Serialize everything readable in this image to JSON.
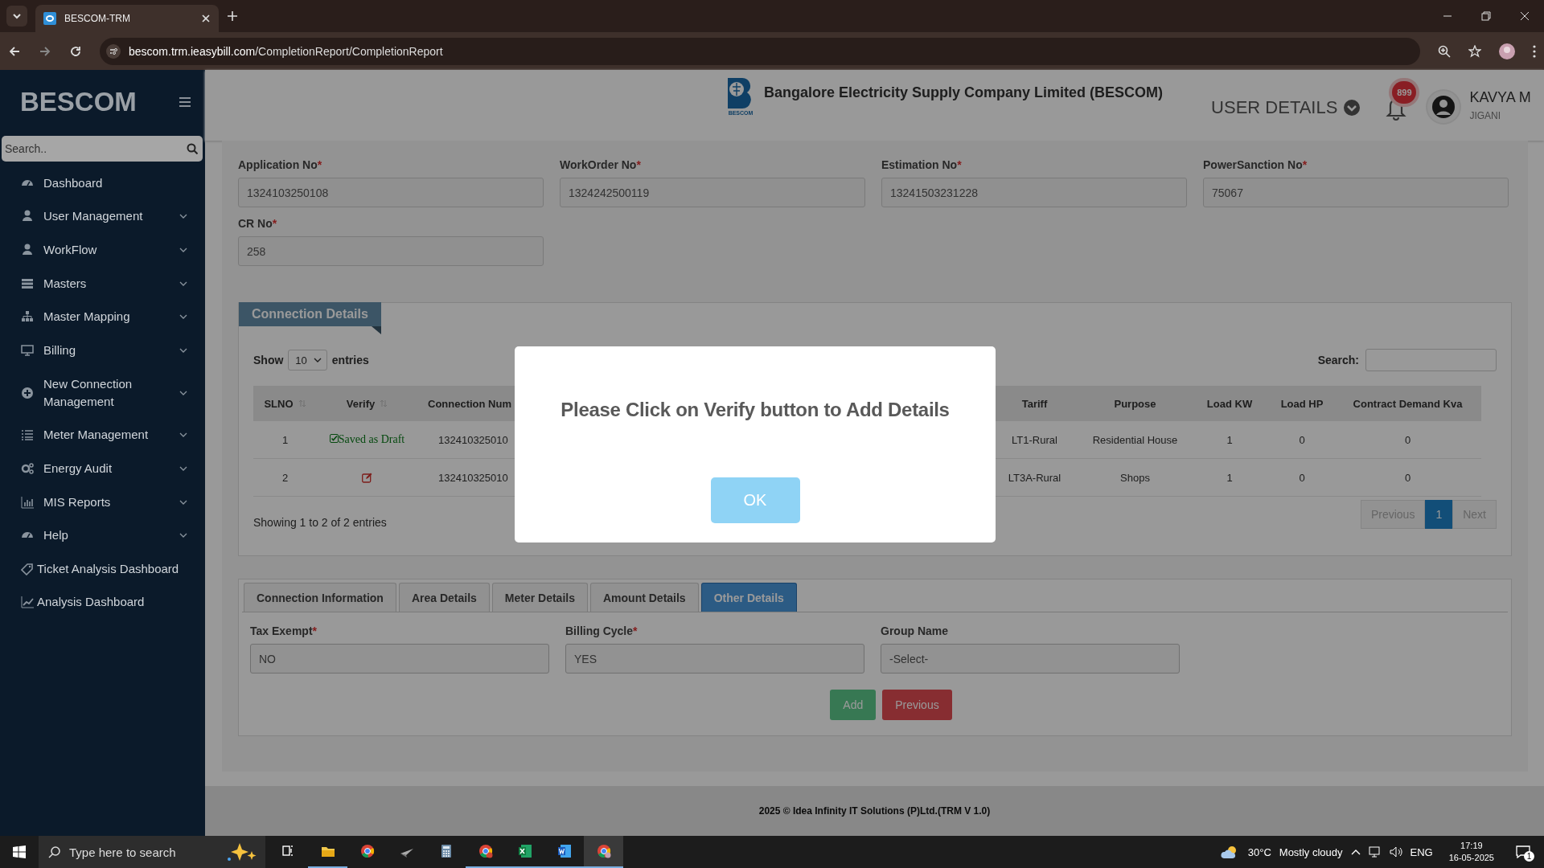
{
  "browser": {
    "tab_title": "BESCOM-TRM",
    "url_host": "bescom.trm.ieasybill.com",
    "url_path": "/CompletionReport/CompletionReport"
  },
  "sidebar": {
    "logo": "BESCOM",
    "search_placeholder": "Search..",
    "items": [
      {
        "label": "Dashboard",
        "submenu": false
      },
      {
        "label": "User Management",
        "submenu": true
      },
      {
        "label": "WorkFlow",
        "submenu": true
      },
      {
        "label": "Masters",
        "submenu": true
      },
      {
        "label": "Master Mapping",
        "submenu": true
      },
      {
        "label": "Billing",
        "submenu": true
      },
      {
        "label": "New Connection Management",
        "submenu": true
      },
      {
        "label": "Meter Management",
        "submenu": true
      },
      {
        "label": "Energy Audit",
        "submenu": true
      },
      {
        "label": "MIS Reports",
        "submenu": true
      },
      {
        "label": "Help",
        "submenu": true
      },
      {
        "label": "Ticket Analysis Dashboard",
        "submenu": false
      },
      {
        "label": "Analysis Dashboard",
        "submenu": false
      }
    ]
  },
  "header": {
    "logo_caption": "BESCOM",
    "company": "Bangalore Electricity Supply Company Limited (BESCOM)",
    "user_menu": "USER DETAILS",
    "notifications": "899",
    "user_name": "KAVYA M",
    "user_location": "JIGANI"
  },
  "fields": [
    {
      "label": "Application No",
      "mark": "*",
      "value": "1324103250108"
    },
    {
      "label": "WorkOrder No",
      "mark": "*",
      "value": "1324242500119"
    },
    {
      "label": "Estimation No",
      "mark": "*",
      "value": "13241503231228"
    },
    {
      "label": "PowerSanction No",
      "mark": "*",
      "value": "75067"
    },
    {
      "label": "CR No",
      "mark": "*",
      "value": "258"
    }
  ],
  "connection_details": {
    "title": "Connection Details",
    "show_label": "Show",
    "page_size": "10",
    "entries_label": "entries",
    "search_label": "Search:",
    "columns": [
      {
        "label": "SLNO",
        "sortable": true
      },
      {
        "label": "Verify",
        "sortable": true
      },
      {
        "label": "Connection Num",
        "sortable": false
      },
      {
        "label": "Tariff",
        "sortable": false
      },
      {
        "label": "Purpose",
        "sortable": false
      },
      {
        "label": "Load KW",
        "sortable": false
      },
      {
        "label": "Load HP",
        "sortable": false
      },
      {
        "label": "Contract Demand Kva",
        "sortable": false
      }
    ],
    "rows": [
      {
        "slno": "1",
        "verify": {
          "kind": "draft",
          "text": "Saved as Draft"
        },
        "connection_number": "132410325010",
        "tariff": "LT1-Rural",
        "purpose": "Residential House",
        "load_kw": "1",
        "load_hp": "0",
        "contract_demand_kva": "0"
      },
      {
        "slno": "2",
        "verify": {
          "kind": "edit"
        },
        "connection_number": "132410325010",
        "tariff": "LT3A-Rural",
        "purpose": "Shops",
        "load_kw": "1",
        "load_hp": "0",
        "contract_demand_kva": "0"
      }
    ],
    "info": "Showing 1 to 2 of 2 entries",
    "pagination": [
      {
        "label": "Previous",
        "selected": false,
        "disabled": true
      },
      {
        "label": "1",
        "selected": true,
        "disabled": false
      },
      {
        "label": "Next",
        "selected": false,
        "disabled": true
      }
    ]
  },
  "detail_tabs": [
    {
      "label": "Connection Information",
      "selected": false
    },
    {
      "label": "Area Details",
      "selected": false
    },
    {
      "label": "Meter Details",
      "selected": false
    },
    {
      "label": "Amount Details",
      "selected": false
    },
    {
      "label": "Other Details",
      "selected": true
    }
  ],
  "other_details": {
    "fields": [
      {
        "label": "Tax Exempt",
        "mark": "*",
        "value": "NO"
      },
      {
        "label": "Billing Cycle",
        "mark": "*",
        "value": "YES"
      },
      {
        "label": "Group Name",
        "value": "-Select-"
      }
    ],
    "buttons": [
      {
        "label": "Add",
        "kind": "success"
      },
      {
        "label": "Previous",
        "kind": "danger"
      }
    ]
  },
  "footer": "2025 © Idea Infinity IT Solutions (P)Ltd.(TRM V 1.0)",
  "modal": {
    "message": "Please Click on Verify button to Add Details",
    "button": "OK"
  },
  "taskbar": {
    "search_placeholder": "Type here to search",
    "temperature": "30°C",
    "weather": "Mostly cloudy",
    "language": "ENG",
    "time": "17:19",
    "date": "16-05-2025",
    "notifications": "1"
  }
}
